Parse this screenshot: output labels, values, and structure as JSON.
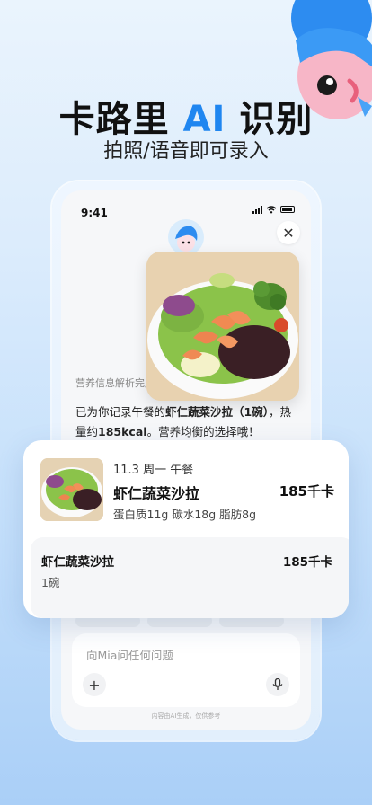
{
  "headline": {
    "part1": "卡路里 ",
    "part2": "AI",
    "part3": " 识别"
  },
  "subhead": "拍照/语音即可录入",
  "status_bar": {
    "time": "9:41"
  },
  "chat": {
    "status": "营养信息解析完成",
    "msg_pre": "已为你记录午餐的",
    "msg_item": "虾仁蔬菜沙拉（1碗）",
    "msg_mid": "，热量约",
    "msg_kcal": "185kcal",
    "msg_post": "。营养均衡的选择哦！"
  },
  "input": {
    "placeholder": "向Mia问任何问题",
    "disclaimer": "内容由AI生成，仅供参考"
  },
  "record": {
    "date": "11.3 周一 午餐",
    "name": "虾仁蔬菜沙拉",
    "kcal": "185千卡",
    "macros": "蛋白质11g 碳水18g 脂肪8g",
    "detail": {
      "name": "虾仁蔬菜沙拉",
      "kcal": "185千卡",
      "qty": "1碗"
    }
  },
  "icons": {
    "close": "close-icon",
    "plus": "plus-icon",
    "mic": "microphone-icon"
  },
  "colors": {
    "accent": "#1f86f0"
  }
}
